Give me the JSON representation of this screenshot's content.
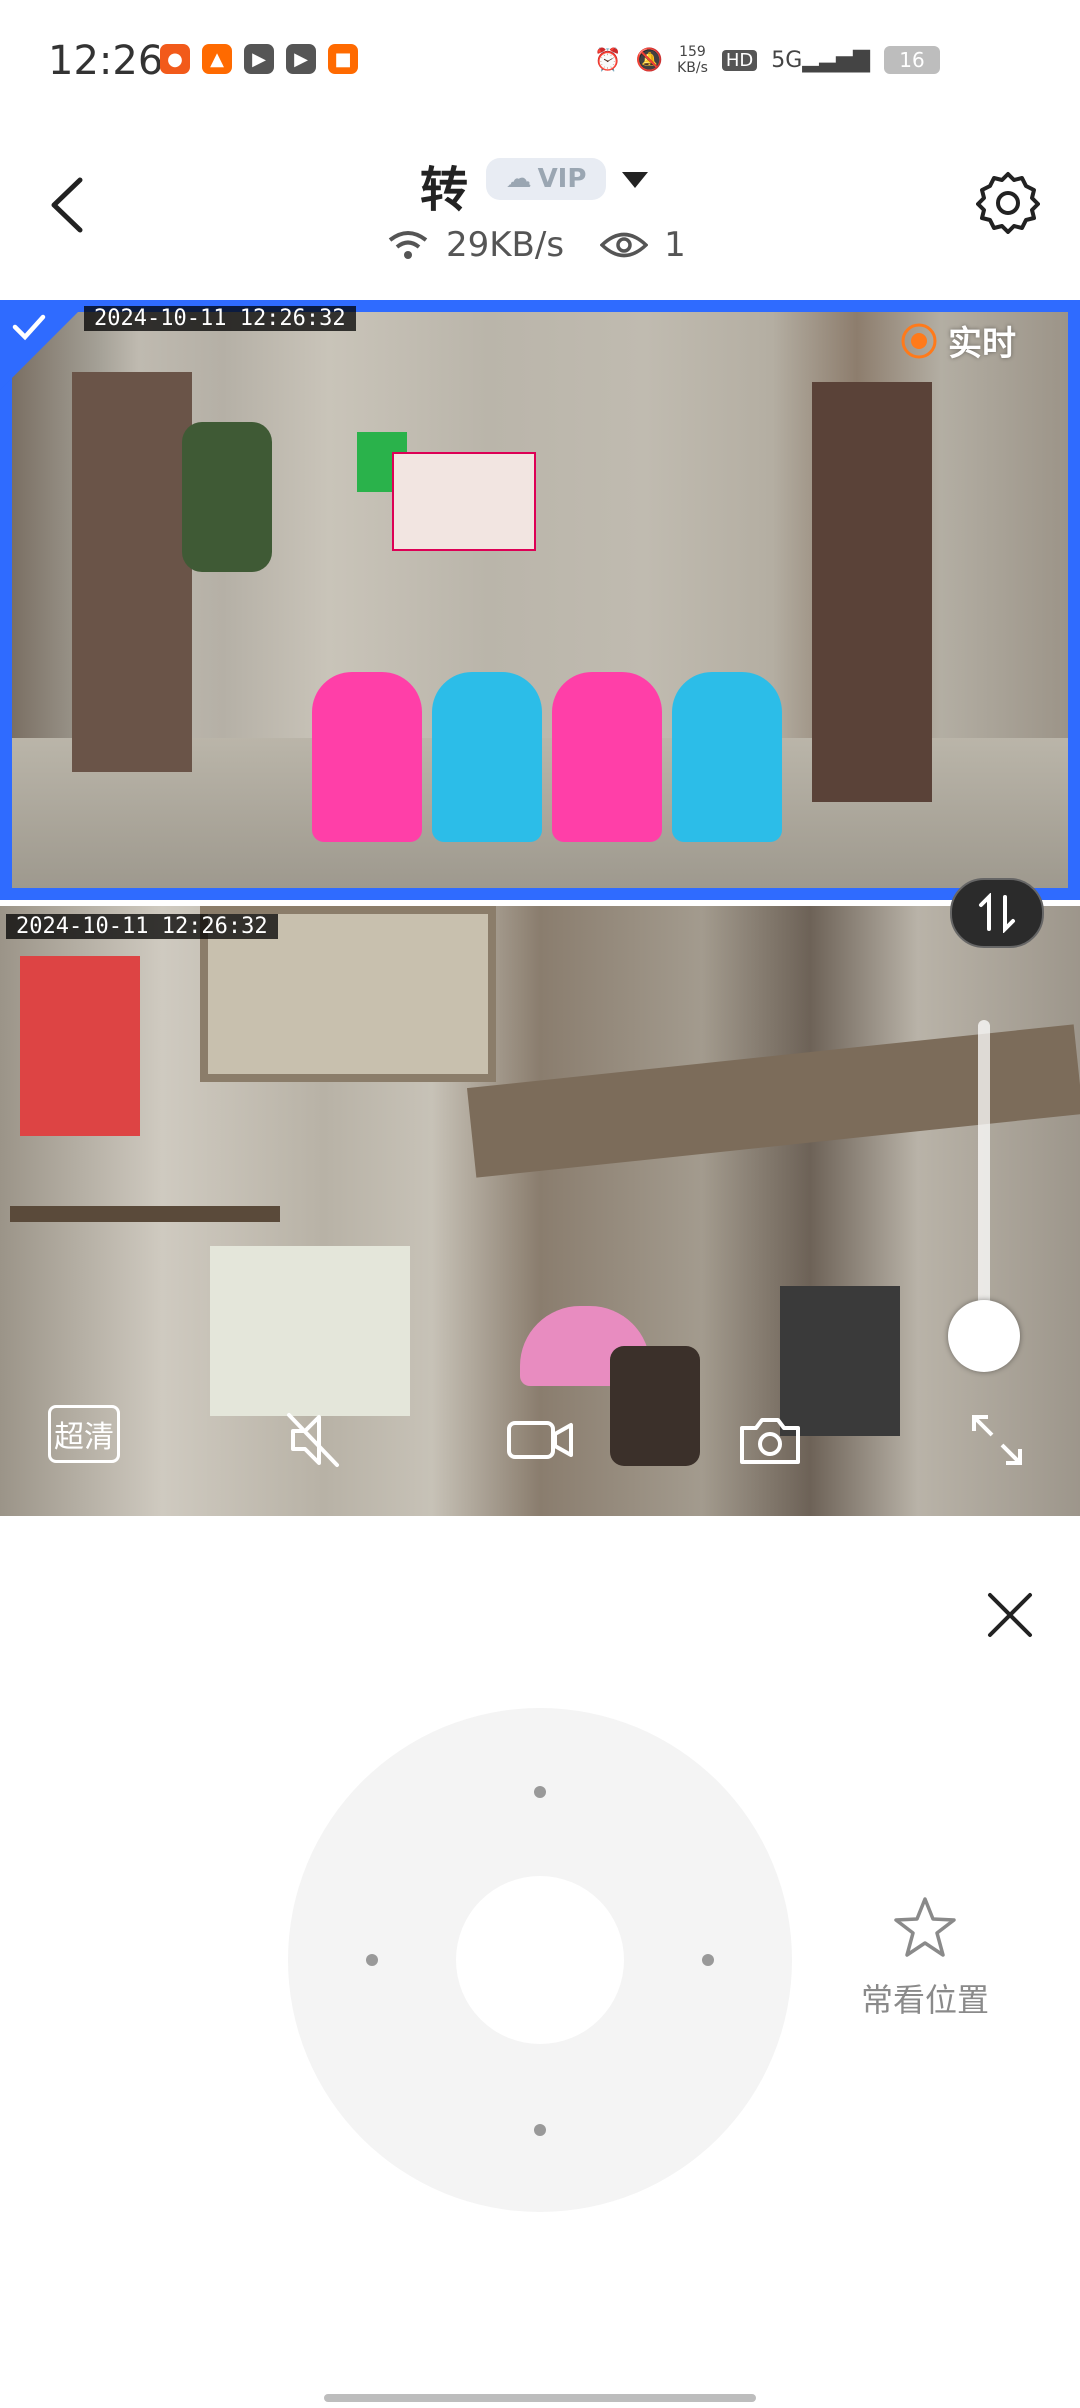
{
  "status_bar": {
    "time": "12:26",
    "network_speed_value": "159",
    "network_speed_unit": "KB/s",
    "hd_badge": "HD",
    "signal": "5G",
    "battery": "16"
  },
  "header": {
    "title": "转",
    "vip_label": "VIP",
    "bitrate": "29KB/s",
    "viewers": "1"
  },
  "camera_main": {
    "timestamp": "2024-10-11  12:26:32",
    "live_label": "实时"
  },
  "camera_secondary": {
    "timestamp": "2024-10-11  12:26:32"
  },
  "controls": {
    "quality_label": "超清"
  },
  "ptz": {
    "favorite_label": "常看位置"
  },
  "colors": {
    "accent": "#2f6bff",
    "live_orange": "#ff7a1a",
    "vip_bg": "#e8ecf3"
  },
  "icons": {
    "back": "chevron-left-icon",
    "settings": "gear-icon",
    "wifi": "wifi-icon",
    "viewers": "eye-icon",
    "mute": "mute-icon",
    "record": "video-record-icon",
    "snapshot": "camera-icon",
    "fullscreen": "fullscreen-icon",
    "swap": "swap-icon",
    "close": "close-icon",
    "favorite": "star-icon"
  }
}
